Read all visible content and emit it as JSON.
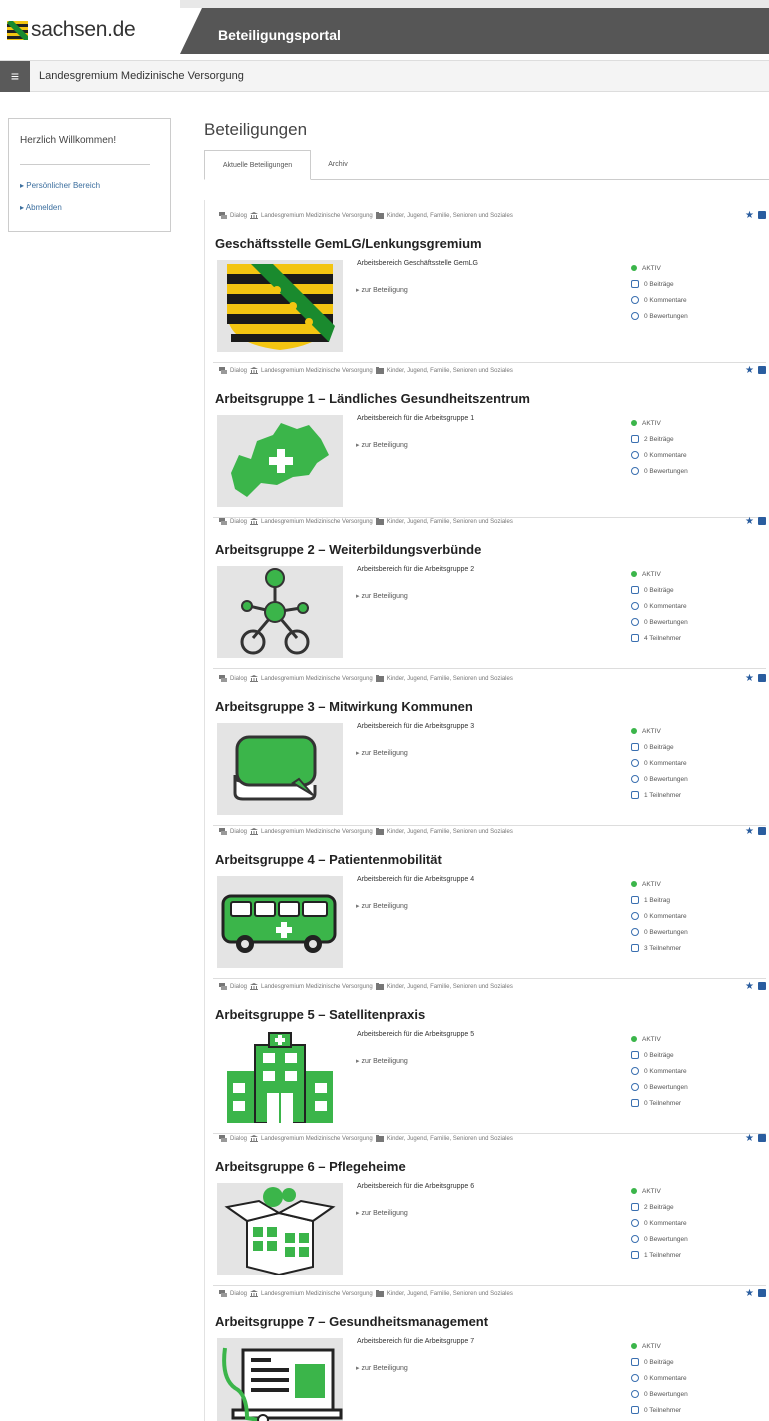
{
  "header": {
    "logo_text": "sachsen.de",
    "portal_title": "Beteiligungsportal"
  },
  "subbar": {
    "menu_icon": "hamburger-icon",
    "title": "Landesgremium Medizinische Versorgung"
  },
  "sidebar": {
    "welcome": "Herzlich Willkommen!",
    "links": [
      {
        "label": "Persönlicher Bereich"
      },
      {
        "label": "Abmelden"
      }
    ]
  },
  "main": {
    "title": "Beteiligungen",
    "tabs": [
      {
        "label": "Aktuelle Beteiligungen",
        "active": true
      },
      {
        "label": "Archiv",
        "active": false
      }
    ]
  },
  "meta": {
    "type": "Dialog",
    "org": "Landesgremium Medizinische Versorgung",
    "topic": "Kinder, Jugend, Familie, Senioren und Soziales"
  },
  "go_label": "zur Beteiligung",
  "colors": {
    "accent": "#3bb54a",
    "link": "#3b6e9e",
    "icon_blue": "#2a5d9f"
  },
  "cards": [
    {
      "title": "Geschäftsstelle GemLG/Lenkungsgremium",
      "desc": "Arbeitsbereich Geschäftsstelle GemLG",
      "image": "coat-of-arms-saxony",
      "status": "AKTIV",
      "stats": [
        "0 Beiträge",
        "0 Kommentare",
        "0 Bewertungen"
      ]
    },
    {
      "title": "Arbeitsgruppe 1 – Ländliches Gesundheitszentrum",
      "desc": "Arbeitsbereich für die Arbeitsgruppe 1",
      "image": "saxony-map-cross",
      "status": "AKTIV",
      "stats": [
        "2 Beiträge",
        "0 Kommentare",
        "0 Bewertungen"
      ]
    },
    {
      "title": "Arbeitsgruppe 2 – Weiterbildungsverbünde",
      "desc": "Arbeitsbereich für die Arbeitsgruppe 2",
      "image": "network-nodes",
      "status": "AKTIV",
      "stats": [
        "0 Beiträge",
        "0 Kommentare",
        "0 Bewertungen",
        "4 Teilnehmer"
      ]
    },
    {
      "title": "Arbeitsgruppe 3 – Mitwirkung Kommunen",
      "desc": "Arbeitsbereich für die Arbeitsgruppe 3",
      "image": "speech-bubbles",
      "status": "AKTIV",
      "stats": [
        "0 Beiträge",
        "0 Kommentare",
        "0 Bewertungen",
        "1 Teilnehmer"
      ]
    },
    {
      "title": "Arbeitsgruppe 4 – Patientenmobilität",
      "desc": "Arbeitsbereich für die Arbeitsgruppe 4",
      "image": "bus",
      "status": "AKTIV",
      "stats": [
        "1 Beitrag",
        "0 Kommentare",
        "0 Bewertungen",
        "3 Teilnehmer"
      ]
    },
    {
      "title": "Arbeitsgruppe 5 – Satellitenpraxis",
      "desc": "Arbeitsbereich für die Arbeitsgruppe 5",
      "image": "hospital",
      "status": "AKTIV",
      "stats": [
        "0 Beiträge",
        "0 Kommentare",
        "0 Bewertungen",
        "0 Teilnehmer"
      ]
    },
    {
      "title": "Arbeitsgruppe 6 – Pflegeheime",
      "desc": "Arbeitsbereich für die Arbeitsgruppe 6",
      "image": "care-box",
      "status": "AKTIV",
      "stats": [
        "2 Beiträge",
        "0 Kommentare",
        "0 Bewertungen",
        "1 Teilnehmer"
      ]
    },
    {
      "title": "Arbeitsgruppe 7 – Gesundheitsmanagement",
      "desc": "Arbeitsbereich für die Arbeitsgruppe 7",
      "image": "laptop-stethoscope",
      "status": "AKTIV",
      "stats": [
        "0 Beiträge",
        "0 Kommentare",
        "0 Bewertungen",
        "0 Teilnehmer"
      ]
    }
  ]
}
